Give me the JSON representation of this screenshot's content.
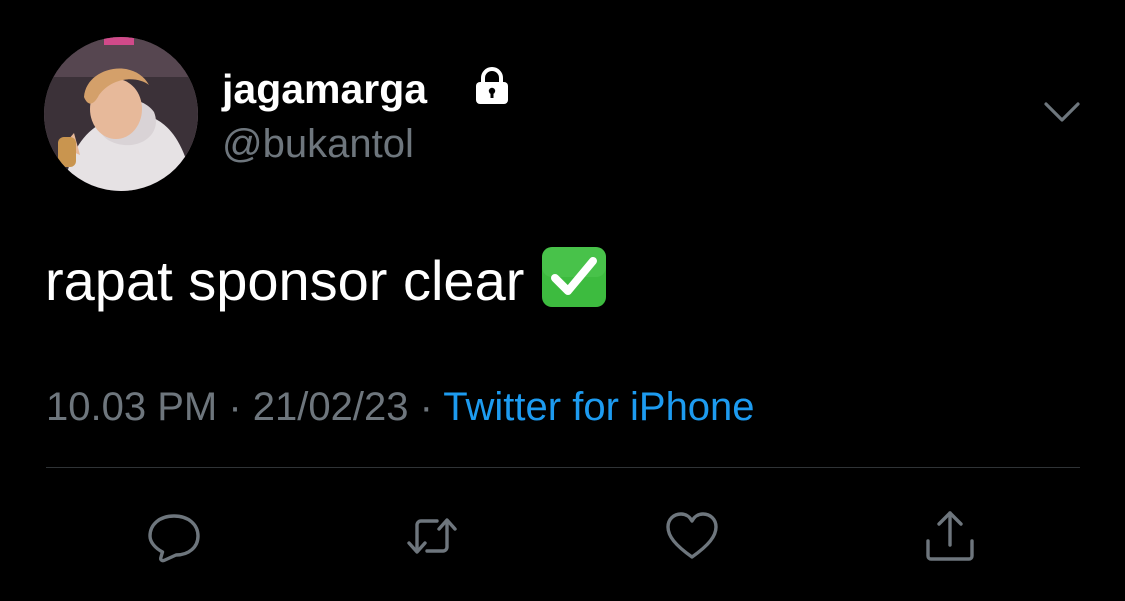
{
  "user": {
    "display_name": "jagamarga",
    "handle": "@bukantol",
    "protected_icon": "lock-icon"
  },
  "tweet": {
    "text": "rapat sponsor clear",
    "emoji": "check-mark-button-emoji"
  },
  "meta": {
    "time": "10.03 PM",
    "separator1": " · ",
    "date": "21/02/23",
    "separator2": " · ",
    "source": "Twitter for iPhone"
  },
  "actions": {
    "reply_icon": "reply-icon",
    "retweet_icon": "retweet-icon",
    "like_icon": "heart-icon",
    "share_icon": "share-icon"
  },
  "colors": {
    "background": "#000000",
    "primary_text": "#ffffff",
    "secondary_text": "#6e767d",
    "link": "#1d9bf0",
    "emoji_green": "#3dbb3f"
  }
}
